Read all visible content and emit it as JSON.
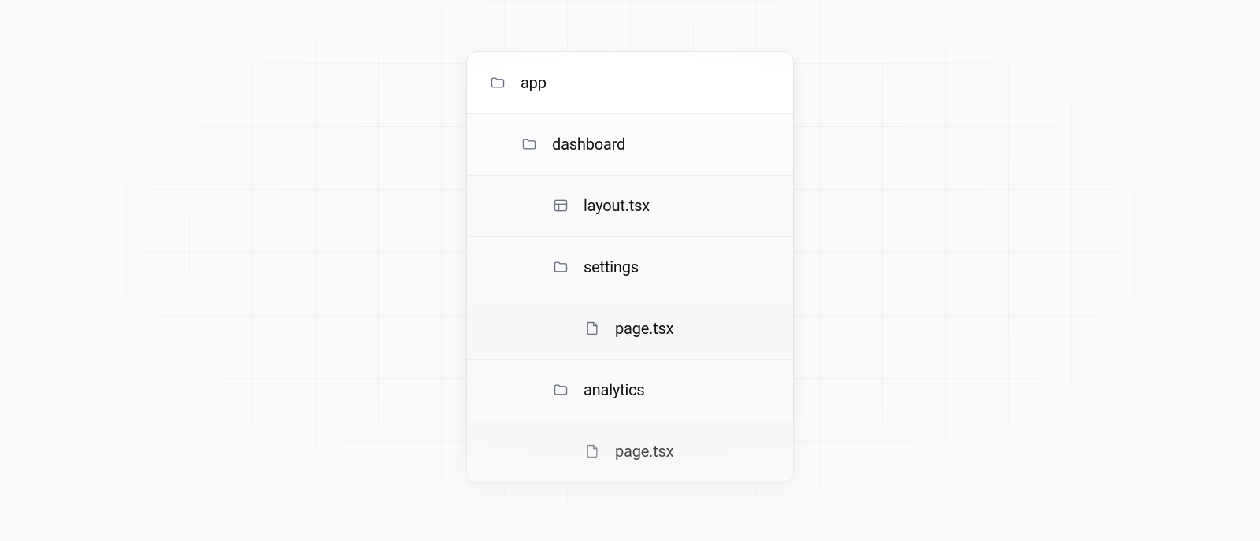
{
  "tree": {
    "items": [
      {
        "label": "app",
        "icon": "folder",
        "depth": 0,
        "shade": 0
      },
      {
        "label": "dashboard",
        "icon": "folder",
        "depth": 1,
        "shade": 1
      },
      {
        "label": "layout.tsx",
        "icon": "layout",
        "depth": 2,
        "shade": 2
      },
      {
        "label": "settings",
        "icon": "folder",
        "depth": 2,
        "shade": 2
      },
      {
        "label": "page.tsx",
        "icon": "file",
        "depth": 3,
        "shade": 3
      },
      {
        "label": "analytics",
        "icon": "folder",
        "depth": 2,
        "shade": 2
      },
      {
        "label": "page.tsx",
        "icon": "file",
        "depth": 3,
        "shade": 3
      }
    ]
  }
}
